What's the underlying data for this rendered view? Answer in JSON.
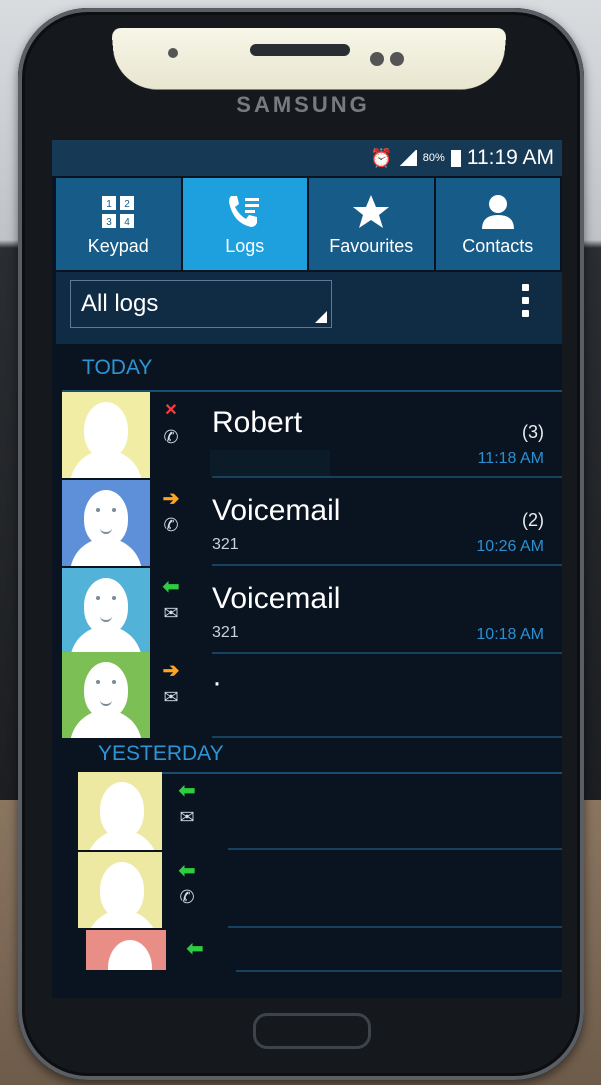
{
  "device": {
    "brand": "SAMSUNG"
  },
  "status_bar": {
    "battery": "80%",
    "time": "11:19 AM",
    "icons": [
      "alarm-icon",
      "signal-icon",
      "battery-icon"
    ]
  },
  "tabs": [
    {
      "label": "Keypad",
      "icon": "keypad-icon",
      "active": false
    },
    {
      "label": "Logs",
      "icon": "call-log-icon",
      "active": true
    },
    {
      "label": "Favourites",
      "icon": "star-icon",
      "active": false
    },
    {
      "label": "Contacts",
      "icon": "contact-icon",
      "active": false
    }
  ],
  "filter": {
    "selected": "All logs",
    "menu_icon": "more-options-icon"
  },
  "sections": [
    {
      "label": "TODAY",
      "entries": [
        {
          "name": "Robert",
          "number": "",
          "count": "(3)",
          "time": "11:18 AM",
          "direction": "missed",
          "type": "call",
          "avatar_color": "#f2eda4"
        },
        {
          "name": "Voicemail",
          "number": "321",
          "count": "(2)",
          "time": "10:26 AM",
          "direction": "outgoing",
          "type": "call",
          "avatar_color": "#5e8fd9"
        },
        {
          "name": "Voicemail",
          "number": "321",
          "count": "",
          "time": "10:18 AM",
          "direction": "incoming",
          "type": "message",
          "avatar_color": "#52b2d8"
        },
        {
          "name": "·",
          "number": "",
          "count": "",
          "time": "",
          "direction": "outgoing",
          "type": "message",
          "avatar_color": "#7cbf55"
        }
      ]
    },
    {
      "label": "YESTERDAY",
      "entries": [
        {
          "name": "",
          "number": "",
          "count": "",
          "time": "",
          "direction": "incoming",
          "type": "message",
          "avatar_color": "#eee9a2"
        },
        {
          "name": "",
          "number": "",
          "count": "",
          "time": "",
          "direction": "incoming",
          "type": "call",
          "avatar_color": "#eee9a2"
        },
        {
          "name": "",
          "number": "",
          "count": "",
          "time": "",
          "direction": "incoming",
          "type": "call",
          "avatar_color": "#e98e86"
        }
      ]
    }
  ],
  "colors": {
    "accent": "#1ea0de",
    "tab_bg": "#175b88",
    "incoming": "#2ecc40",
    "outgoing": "#ffa41f",
    "missed": "#ff3b3b"
  }
}
